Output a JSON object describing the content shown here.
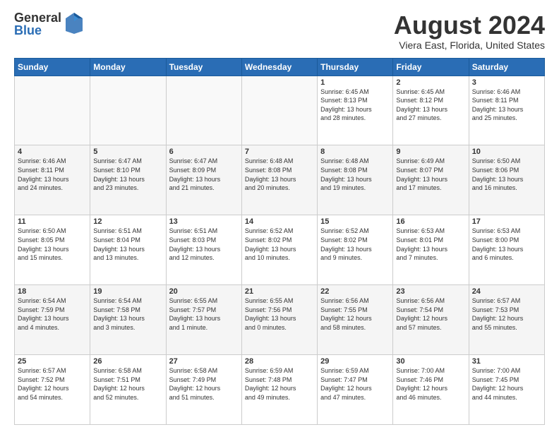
{
  "logo": {
    "general": "General",
    "blue": "Blue"
  },
  "title": "August 2024",
  "location": "Viera East, Florida, United States",
  "days_of_week": [
    "Sunday",
    "Monday",
    "Tuesday",
    "Wednesday",
    "Thursday",
    "Friday",
    "Saturday"
  ],
  "weeks": [
    [
      {
        "day": "",
        "info": ""
      },
      {
        "day": "",
        "info": ""
      },
      {
        "day": "",
        "info": ""
      },
      {
        "day": "",
        "info": ""
      },
      {
        "day": "1",
        "info": "Sunrise: 6:45 AM\nSunset: 8:13 PM\nDaylight: 13 hours\nand 28 minutes."
      },
      {
        "day": "2",
        "info": "Sunrise: 6:45 AM\nSunset: 8:12 PM\nDaylight: 13 hours\nand 27 minutes."
      },
      {
        "day": "3",
        "info": "Sunrise: 6:46 AM\nSunset: 8:11 PM\nDaylight: 13 hours\nand 25 minutes."
      }
    ],
    [
      {
        "day": "4",
        "info": "Sunrise: 6:46 AM\nSunset: 8:11 PM\nDaylight: 13 hours\nand 24 minutes."
      },
      {
        "day": "5",
        "info": "Sunrise: 6:47 AM\nSunset: 8:10 PM\nDaylight: 13 hours\nand 23 minutes."
      },
      {
        "day": "6",
        "info": "Sunrise: 6:47 AM\nSunset: 8:09 PM\nDaylight: 13 hours\nand 21 minutes."
      },
      {
        "day": "7",
        "info": "Sunrise: 6:48 AM\nSunset: 8:08 PM\nDaylight: 13 hours\nand 20 minutes."
      },
      {
        "day": "8",
        "info": "Sunrise: 6:48 AM\nSunset: 8:08 PM\nDaylight: 13 hours\nand 19 minutes."
      },
      {
        "day": "9",
        "info": "Sunrise: 6:49 AM\nSunset: 8:07 PM\nDaylight: 13 hours\nand 17 minutes."
      },
      {
        "day": "10",
        "info": "Sunrise: 6:50 AM\nSunset: 8:06 PM\nDaylight: 13 hours\nand 16 minutes."
      }
    ],
    [
      {
        "day": "11",
        "info": "Sunrise: 6:50 AM\nSunset: 8:05 PM\nDaylight: 13 hours\nand 15 minutes."
      },
      {
        "day": "12",
        "info": "Sunrise: 6:51 AM\nSunset: 8:04 PM\nDaylight: 13 hours\nand 13 minutes."
      },
      {
        "day": "13",
        "info": "Sunrise: 6:51 AM\nSunset: 8:03 PM\nDaylight: 13 hours\nand 12 minutes."
      },
      {
        "day": "14",
        "info": "Sunrise: 6:52 AM\nSunset: 8:02 PM\nDaylight: 13 hours\nand 10 minutes."
      },
      {
        "day": "15",
        "info": "Sunrise: 6:52 AM\nSunset: 8:02 PM\nDaylight: 13 hours\nand 9 minutes."
      },
      {
        "day": "16",
        "info": "Sunrise: 6:53 AM\nSunset: 8:01 PM\nDaylight: 13 hours\nand 7 minutes."
      },
      {
        "day": "17",
        "info": "Sunrise: 6:53 AM\nSunset: 8:00 PM\nDaylight: 13 hours\nand 6 minutes."
      }
    ],
    [
      {
        "day": "18",
        "info": "Sunrise: 6:54 AM\nSunset: 7:59 PM\nDaylight: 13 hours\nand 4 minutes."
      },
      {
        "day": "19",
        "info": "Sunrise: 6:54 AM\nSunset: 7:58 PM\nDaylight: 13 hours\nand 3 minutes."
      },
      {
        "day": "20",
        "info": "Sunrise: 6:55 AM\nSunset: 7:57 PM\nDaylight: 13 hours\nand 1 minute."
      },
      {
        "day": "21",
        "info": "Sunrise: 6:55 AM\nSunset: 7:56 PM\nDaylight: 13 hours\nand 0 minutes."
      },
      {
        "day": "22",
        "info": "Sunrise: 6:56 AM\nSunset: 7:55 PM\nDaylight: 12 hours\nand 58 minutes."
      },
      {
        "day": "23",
        "info": "Sunrise: 6:56 AM\nSunset: 7:54 PM\nDaylight: 12 hours\nand 57 minutes."
      },
      {
        "day": "24",
        "info": "Sunrise: 6:57 AM\nSunset: 7:53 PM\nDaylight: 12 hours\nand 55 minutes."
      }
    ],
    [
      {
        "day": "25",
        "info": "Sunrise: 6:57 AM\nSunset: 7:52 PM\nDaylight: 12 hours\nand 54 minutes."
      },
      {
        "day": "26",
        "info": "Sunrise: 6:58 AM\nSunset: 7:51 PM\nDaylight: 12 hours\nand 52 minutes."
      },
      {
        "day": "27",
        "info": "Sunrise: 6:58 AM\nSunset: 7:49 PM\nDaylight: 12 hours\nand 51 minutes."
      },
      {
        "day": "28",
        "info": "Sunrise: 6:59 AM\nSunset: 7:48 PM\nDaylight: 12 hours\nand 49 minutes."
      },
      {
        "day": "29",
        "info": "Sunrise: 6:59 AM\nSunset: 7:47 PM\nDaylight: 12 hours\nand 47 minutes."
      },
      {
        "day": "30",
        "info": "Sunrise: 7:00 AM\nSunset: 7:46 PM\nDaylight: 12 hours\nand 46 minutes."
      },
      {
        "day": "31",
        "info": "Sunrise: 7:00 AM\nSunset: 7:45 PM\nDaylight: 12 hours\nand 44 minutes."
      }
    ]
  ]
}
